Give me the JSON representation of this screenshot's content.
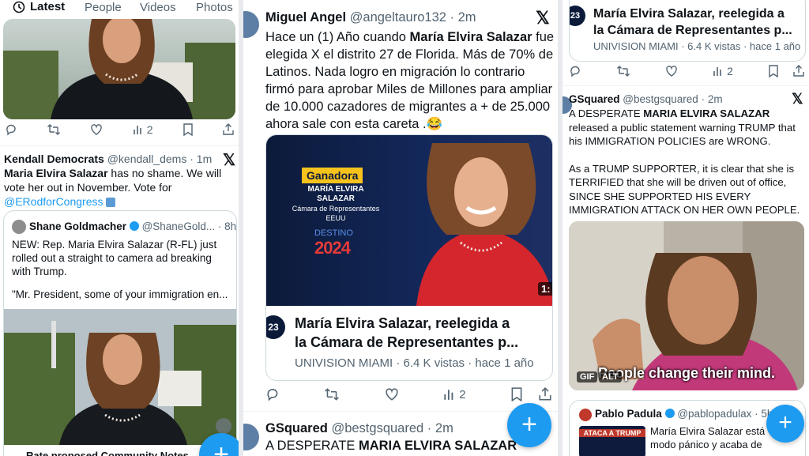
{
  "tabs": [
    "Latest",
    "People",
    "Videos",
    "Photos"
  ],
  "col1": {
    "t1": {
      "views": "2"
    },
    "t2": {
      "name": "Kendall Democrats",
      "handle": "@kendall_dems",
      "time": "1m",
      "text_bold": "Maria Elvira Salazar",
      "text_rest": " has no shame. We will vote her out in November. Vote for ",
      "mention": "@ERodforCongress",
      "quote": {
        "name": "Shane Goldmacher",
        "handle": "@ShaneGold...",
        "time": "8h",
        "line1": "NEW: Rep. Maria Elvira Salazar (R-FL) just",
        "line2": "rolled out a straight to camera ad breaking",
        "line3": "with Trump.",
        "line4": "\"Mr. President, some of your immigration en..."
      },
      "community_notes": "Rate proposed Community Notes"
    }
  },
  "col2": {
    "t1": {
      "name": "Miguel Angel",
      "handle": "@angeltauro132",
      "time": "2m",
      "lines": [
        [
          "Hace un (1) Año cuando ",
          "María Elvira Salazar",
          " fue"
        ],
        [
          "elegida X el distrito 27 de Florida. Más de 70% de",
          "",
          ""
        ],
        [
          "Latinos. Nada logro en migración lo contrario",
          "",
          ""
        ],
        [
          "firmó para aprobar Miles de Millones para ampliar",
          "",
          ""
        ],
        [
          "de 10.000 cazadores de migrantes a + de 25.000",
          "",
          ""
        ],
        [
          "ahora sale con esta careta .😂",
          "",
          ""
        ]
      ],
      "card_badge": "Ganadora",
      "card_name1": "MARÍA ELVIRA",
      "card_name2": "SALAZAR",
      "card_sub1": "Cámara de Representantes",
      "card_sub2": "EEUU",
      "card_destino": "DESTINO",
      "card_year": "2024",
      "card_dur": "1:",
      "link_title1": "María Elvira Salazar, reelegida a",
      "link_title2": "la Cámara de Representantes p...",
      "link_meta": "UNIVISION MIAMI · 6.4 K vistas · hace 1 año",
      "views": "2"
    },
    "t2": {
      "name": "GSquared",
      "handle": "@bestgsquared",
      "time": "2m",
      "text_pre": "A DESPERATE ",
      "text_bold": "MARIA ELVIRA SALAZAR"
    }
  },
  "col3": {
    "t1": {
      "title1": "María Elvira Salazar, reelegida a",
      "title2": "la Cámara de Representantes p...",
      "meta": "UNIVISION MIAMI · 6.4 K vistas · hace 1 año",
      "views": "2"
    },
    "t2": {
      "name": "GSquared",
      "handle": "@bestgsquared",
      "time": "2m",
      "l1_pre": "A DESPERATE ",
      "l1_bold": "MARIA ELVIRA SALAZAR",
      "l2": "released a public statement warning TRUMP that",
      "l3": "his IMMIGRATION POLICIES are WRONG.",
      "l4": "As a TRUMP SUPPORTER, it is clear that she is",
      "l5": "TERRIFIED that she will be driven out of office,",
      "l6": "SINCE SHE SUPPORTED HIS EVERY",
      "l7": "IMMIGRATION ATTACK ON HER OWN PEOPLE.",
      "caption": "People change their mind.",
      "gif": "GIF",
      "alt": "ALT"
    },
    "t3": {
      "name": "Pablo Padula",
      "handle": "@pablopadulax",
      "time": "5h",
      "text1": "María Elvira Salazar está",
      "text2": "modo pánico y acaba de",
      "thumb_text": "ATACA A TRUMP"
    }
  },
  "colors": {
    "accent": "#1d9bf0",
    "text": "#0f1419",
    "muted": "#536471"
  }
}
